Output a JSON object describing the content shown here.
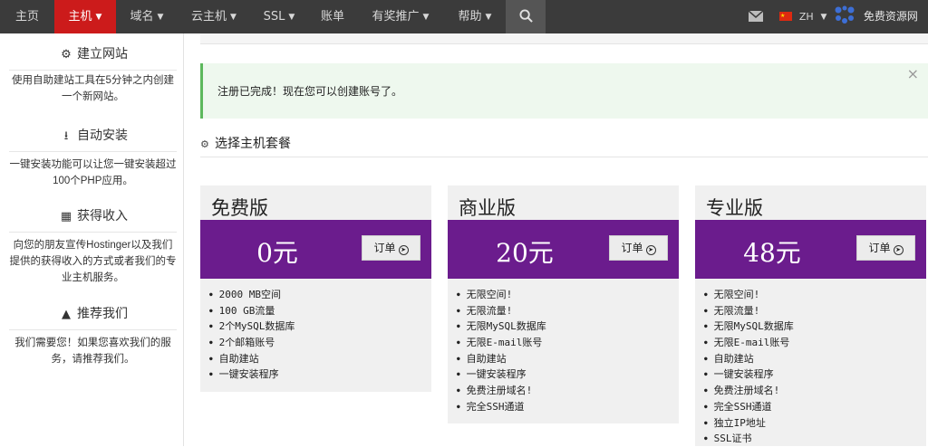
{
  "nav": {
    "items": [
      {
        "label": "主页",
        "dropdown": false
      },
      {
        "label": "主机",
        "dropdown": true,
        "active": true
      },
      {
        "label": "域名",
        "dropdown": true
      },
      {
        "label": "云主机",
        "dropdown": true
      },
      {
        "label": "SSL",
        "dropdown": true
      },
      {
        "label": "账单",
        "dropdown": false
      },
      {
        "label": "有奖推广",
        "dropdown": true
      },
      {
        "label": "帮助",
        "dropdown": true
      }
    ],
    "search_icon": "search-icon",
    "mail_icon": "mail-icon",
    "language": "ZH",
    "site_name": "免费资源网"
  },
  "sidebar": {
    "features": [
      {
        "icon": "gears-icon",
        "title": "建立网站",
        "desc": "使用自助建站工具在5分钟之内创建一个新网站。"
      },
      {
        "icon": "download-icon",
        "title": "自动安装",
        "desc": "一键安装功能可以让您一键安装超过100个PHP应用。"
      },
      {
        "icon": "money-icon",
        "title": "获得收入",
        "desc": "向您的朋友宣传Hostinger以及我们提供的获得收入的方式或者我们的专业主机服务。"
      },
      {
        "icon": "thumbs-up-icon",
        "title": "推荐我们",
        "desc": "我们需要您！如果您喜欢我们的服务，请推荐我们。"
      }
    ]
  },
  "alert": {
    "text": "注册已完成！现在您可以创建账号了。",
    "close": "×"
  },
  "section": {
    "title": "选择主机套餐"
  },
  "plans": [
    {
      "name": "免费版",
      "price": "0元",
      "order_label": "订单",
      "features": [
        "2000 MB空间",
        "100 GB流量",
        "2个MySQL数据库",
        "2个邮箱账号",
        "自助建站",
        "一键安装程序"
      ]
    },
    {
      "name": "商业版",
      "price": "20元",
      "order_label": "订单",
      "features": [
        "无限空间!",
        "无限流量!",
        "无限MySQL数据库",
        "无限E-mail账号",
        "自助建站",
        "一键安装程序",
        "免费注册域名!",
        "完全SSH通道"
      ]
    },
    {
      "name": "专业版",
      "price": "48元",
      "order_label": "订单",
      "features": [
        "无限空间!",
        "无限流量!",
        "无限MySQL数据库",
        "无限E-mail账号",
        "自助建站",
        "一键安装程序",
        "免费注册域名!",
        "完全SSH通道",
        "独立IP地址",
        "SSL证书"
      ]
    }
  ],
  "colors": {
    "nav_bg": "#3b3b3b",
    "nav_active": "#cc1b1b",
    "plan_band": "#6b1c8d",
    "alert_bg": "#eef8ee",
    "alert_border": "#5cb85c"
  }
}
